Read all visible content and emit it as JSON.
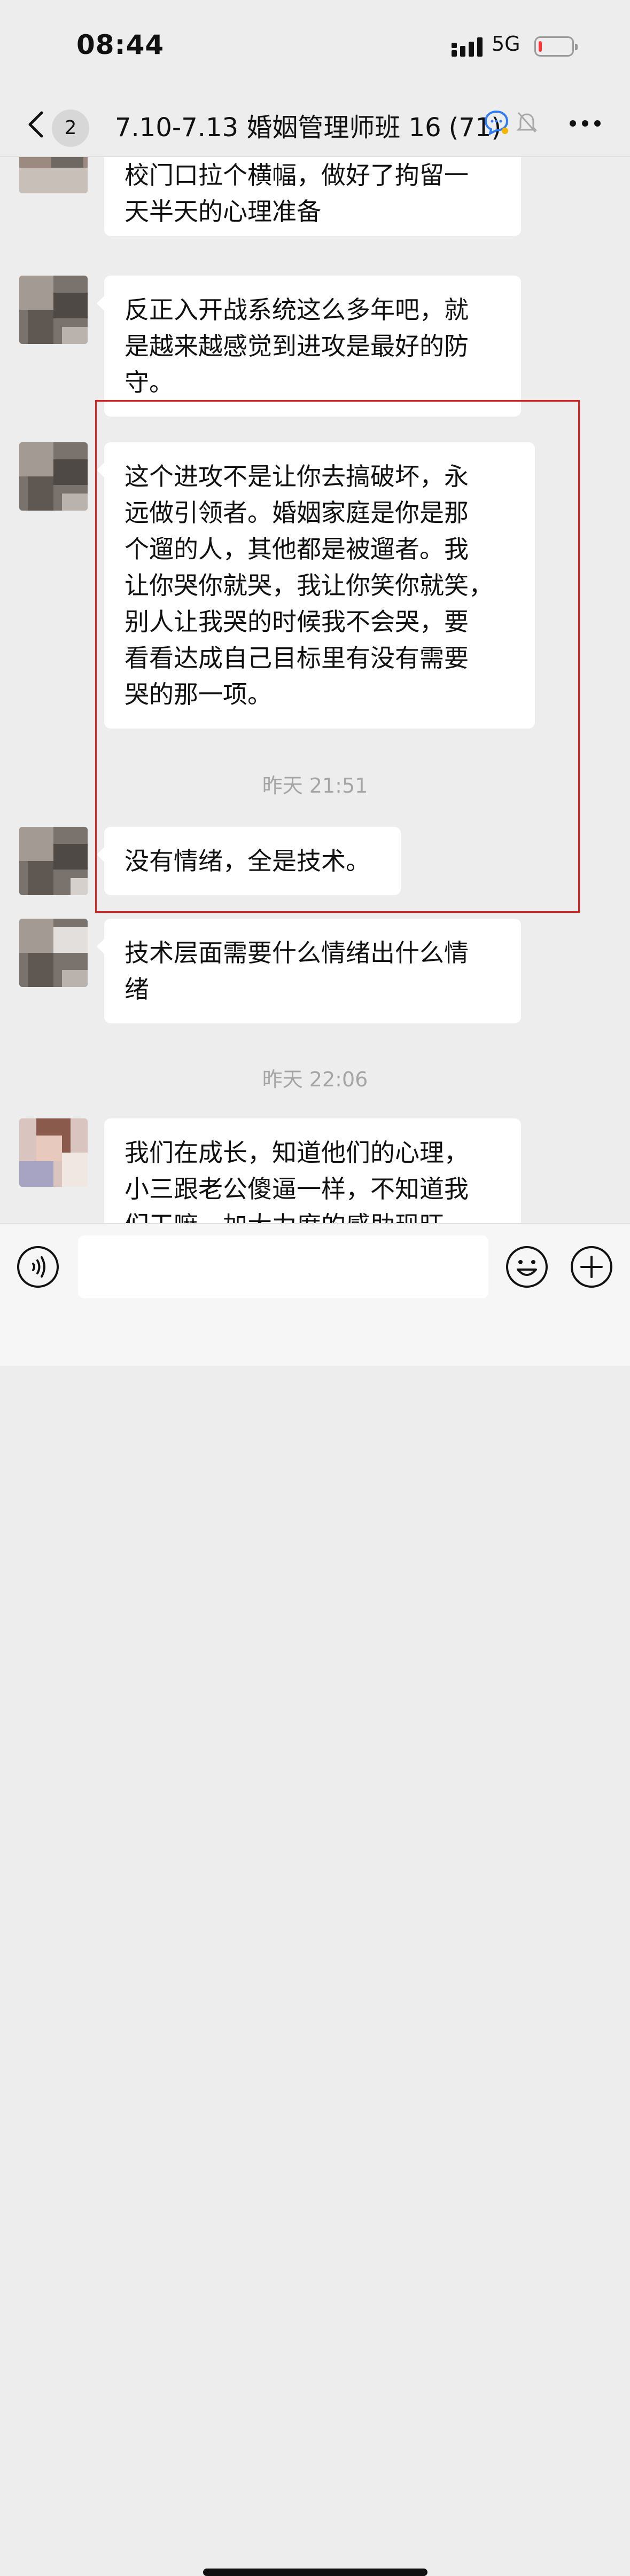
{
  "status_bar": {
    "time": "08:44",
    "network": "5G",
    "battery_level": 0.08
  },
  "nav": {
    "back_icon": "chevron-left",
    "unread_count": "2",
    "title": "7.10-7.13 婚姻管理师班 16",
    "member_count": "(71)",
    "more_icon": "ellipsis"
  },
  "messages": [
    {
      "lines": [
        "校门口拉个横幅，做好了拘留一",
        "天半天的心理准备"
      ]
    },
    {
      "lines": [
        "反正入开战系统这么多年吧，就",
        "是越来越感觉到进攻是最好的防",
        "守。"
      ]
    },
    {
      "lines": [
        "这个进攻不是让你去搞破坏，永",
        "远做引领者。婚姻家庭是你是那",
        "个遛的人，其他都是被遛者。我",
        "让你哭你就哭，我让你笑你就笑，",
        "别人让我哭的时候我不会哭，要",
        "看看达成自己目标里有没有需要",
        "哭的那一项。"
      ]
    },
    {
      "lines": [
        "没有情绪，全是技术。"
      ]
    },
    {
      "lines": [
        "技术层面需要什么情绪出什么情",
        "绪"
      ]
    },
    {
      "lines": [
        "我们在成长，知道他们的心理，",
        "小三跟老公傻逼一样，不知道我",
        "们干嘛，加大力度的感助现旺"
      ]
    }
  ],
  "timestamps": [
    "昨天 21:51",
    "昨天 22:06"
  ],
  "input": {
    "placeholder": ""
  },
  "colors": {
    "background": "#ededed",
    "bubble": "#ffffff",
    "highlight": "#e01f1f",
    "battery_low": "#ff3333"
  }
}
